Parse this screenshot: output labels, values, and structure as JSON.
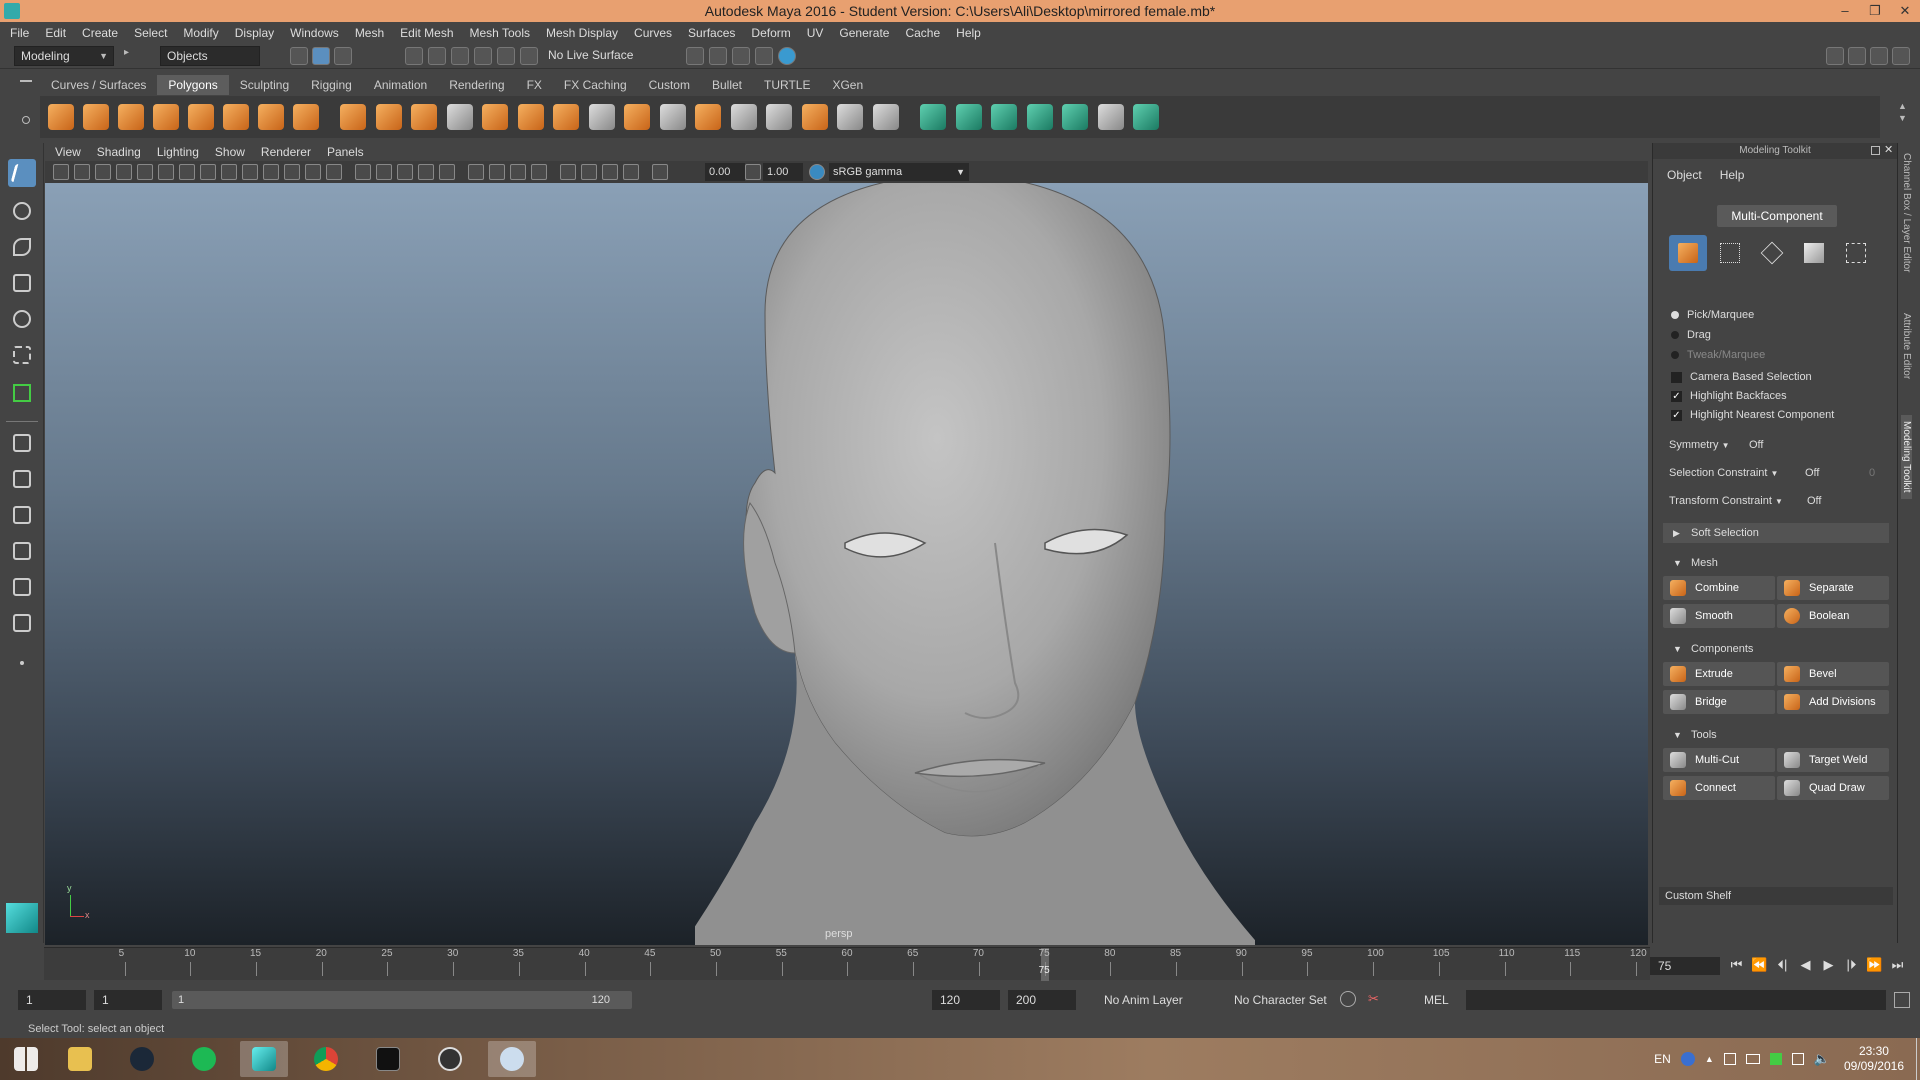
{
  "window": {
    "title": "Autodesk Maya 2016 - Student Version: C:\\Users\\Ali\\Desktop\\mirrored female.mb*",
    "controls": [
      "–",
      "❐",
      "✕"
    ]
  },
  "menubar": [
    "File",
    "Edit",
    "Create",
    "Select",
    "Modify",
    "Display",
    "Windows",
    "Mesh",
    "Edit Mesh",
    "Mesh Tools",
    "Mesh Display",
    "Curves",
    "Surfaces",
    "Deform",
    "UV",
    "Generate",
    "Cache",
    "Help"
  ],
  "statusline": {
    "mode": "Modeling",
    "objects": "Objects",
    "live_surface": "No Live Surface"
  },
  "shelf_tabs": [
    "Curves / Surfaces",
    "Polygons",
    "Sculpting",
    "Rigging",
    "Animation",
    "Rendering",
    "FX",
    "FX Caching",
    "Custom",
    "Bullet",
    "TURTLE",
    "XGen"
  ],
  "shelf_active": "Polygons",
  "viewport": {
    "menu": [
      "View",
      "Shading",
      "Lighting",
      "Show",
      "Renderer",
      "Panels"
    ],
    "exposure": "0.00",
    "gamma": "1.00",
    "color_space": "sRGB gamma",
    "camera_label": "persp",
    "axis_y": "y",
    "axis_x": "x"
  },
  "timeline": {
    "ticks": [
      "5",
      "10",
      "15",
      "20",
      "25",
      "30",
      "35",
      "40",
      "45",
      "50",
      "55",
      "60",
      "65",
      "70",
      "75",
      "80",
      "85",
      "90",
      "95",
      "100",
      "105",
      "110",
      "115",
      "120"
    ],
    "current_frame_label": "75",
    "current_frame": 75,
    "max_frame": 120,
    "current_frame_field": "75",
    "playback_buttons": [
      "⏮",
      "⏪",
      "⏴|",
      "◀",
      "▶",
      "|⏵",
      "⏩",
      "⏭"
    ]
  },
  "range": {
    "start_field": "1",
    "start_field2": "1",
    "slider_start": "1",
    "slider_end": "120",
    "end_field": "120",
    "end_field2": "200",
    "anim_layer": "No Anim Layer",
    "character_set": "No Character Set",
    "script_lang": "MEL"
  },
  "helpline": "Select Tool: select an object",
  "taskbar": {
    "language": "EN",
    "time": "23:30",
    "date": "09/09/2016"
  },
  "toolkit": {
    "title": "Modeling Toolkit",
    "menu": [
      "Object",
      "Help"
    ],
    "multi_component": "Multi-Component",
    "pick_marquee": "Pick/Marquee",
    "drag": "Drag",
    "tweak_marquee": "Tweak/Marquee",
    "camera_based_selection": "Camera Based Selection",
    "highlight_backfaces": "Highlight Backfaces",
    "highlight_nearest": "Highlight Nearest Component",
    "symmetry_label": "Symmetry",
    "symmetry_value": "Off",
    "selection_constraint_label": "Selection Constraint",
    "selection_constraint_value": "Off",
    "selection_constraint_num": "0",
    "transform_constraint_label": "Transform Constraint",
    "transform_constraint_value": "Off",
    "soft_selection": "Soft Selection",
    "mesh_section": "Mesh",
    "combine": "Combine",
    "separate": "Separate",
    "smooth": "Smooth",
    "boolean": "Boolean",
    "components_section": "Components",
    "extrude": "Extrude",
    "bevel": "Bevel",
    "bridge": "Bridge",
    "add_divisions": "Add Divisions",
    "tools_section": "Tools",
    "multi_cut": "Multi-Cut",
    "target_weld": "Target Weld",
    "connect": "Connect",
    "quad_draw": "Quad Draw",
    "custom_shelf": "Custom Shelf"
  },
  "side_tabs": [
    "Channel Box / Layer Editor",
    "Attribute Editor",
    "Modeling Toolkit"
  ],
  "colors": {
    "accent_orange": "#e8a070",
    "selection_blue": "#4a7bb0"
  }
}
